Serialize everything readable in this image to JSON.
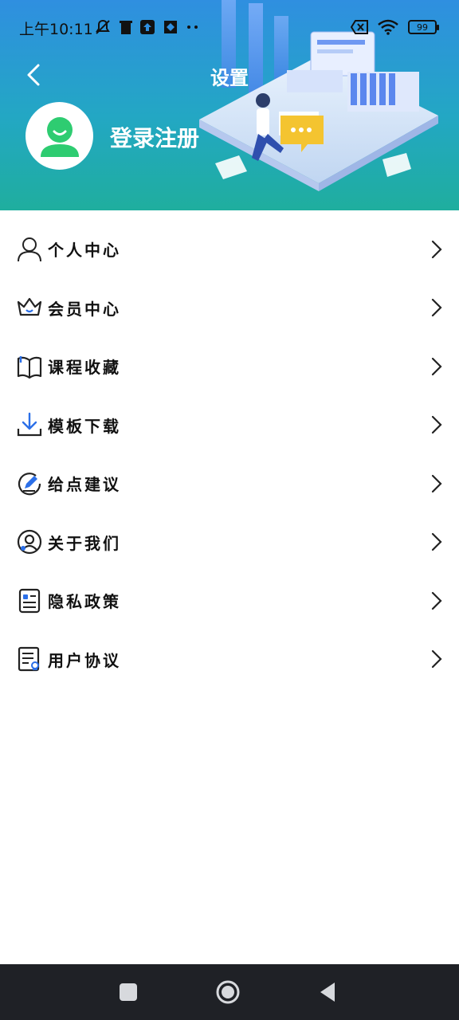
{
  "status_bar": {
    "time": "上午10:11",
    "battery": "99",
    "icons_left": [
      "bell-muted-icon",
      "trash-icon",
      "upload-icon",
      "app-icon",
      "more-dots-icon"
    ],
    "icons_right": [
      "sim-off-icon",
      "wifi-icon",
      "battery-icon"
    ]
  },
  "header": {
    "title": "设置",
    "login_label": "登录注册",
    "gradient": [
      "#2f8fe0",
      "#23a7c4",
      "#1fae9e"
    ]
  },
  "menu": {
    "items": [
      {
        "label": "个人中心",
        "icon": "person-icon"
      },
      {
        "label": "会员中心",
        "icon": "crown-icon"
      },
      {
        "label": "课程收藏",
        "icon": "book-icon"
      },
      {
        "label": "模板下载",
        "icon": "download-icon"
      },
      {
        "label": "给点建议",
        "icon": "feedback-pen-icon"
      },
      {
        "label": "关于我们",
        "icon": "about-user-icon"
      },
      {
        "label": "隐私政策",
        "icon": "privacy-doc-icon"
      },
      {
        "label": "用户协议",
        "icon": "agreement-doc-icon"
      }
    ]
  },
  "colors": {
    "accent": "#2f8fe0",
    "avatar_green": "#2ecc71",
    "icon_blue": "#2b6fe8",
    "navbar": "#1f2126"
  }
}
